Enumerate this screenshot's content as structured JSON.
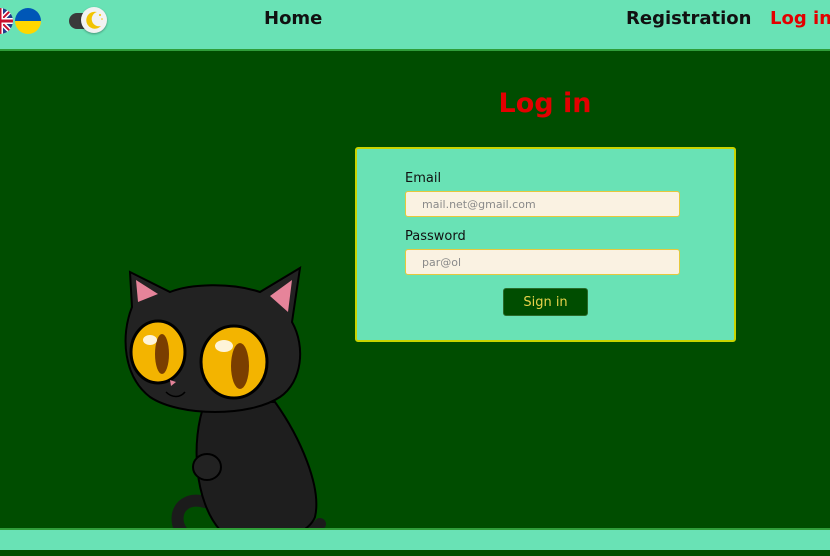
{
  "header": {
    "languages": [
      {
        "name": "uk-flag-icon"
      },
      {
        "name": "ukraine-flag-icon"
      }
    ],
    "theme_toggle": {
      "icon": "moon-icon"
    },
    "nav": {
      "home": "Home",
      "registration": "Registration",
      "login": "Log in"
    }
  },
  "main": {
    "title": "Log in",
    "form": {
      "email_label": "Email",
      "email_placeholder": "mail.net@gmail.com",
      "password_label": "Password",
      "password_placeholder": "par@ol",
      "submit_label": "Sign in"
    },
    "illustration": "black-cat"
  },
  "colors": {
    "header_bg": "#69e2b5",
    "page_bg": "#004d00",
    "accent_red": "#e30000",
    "button_text": "#e6d24a"
  }
}
